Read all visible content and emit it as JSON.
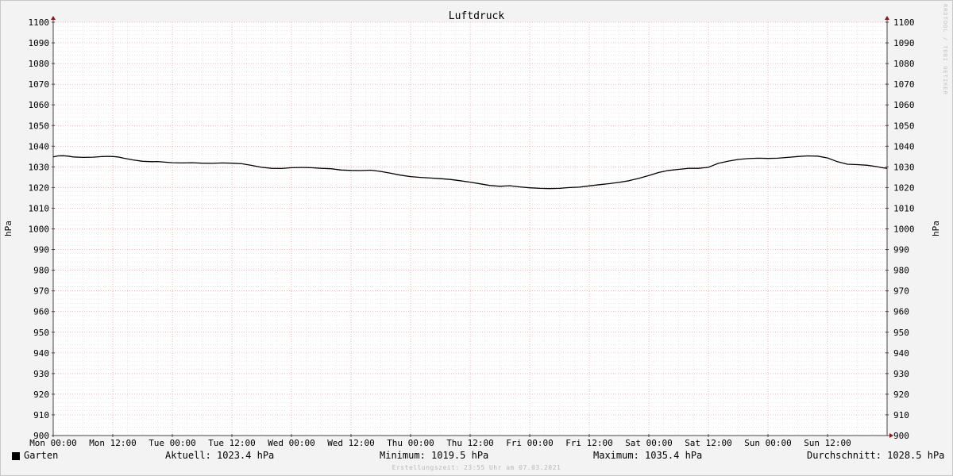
{
  "chart_data": {
    "type": "line",
    "title": "Luftdruck",
    "ylabel_left": "hPa",
    "ylabel_right": "hPa",
    "ylim": [
      900,
      1100
    ],
    "y_ticks": [
      900,
      910,
      920,
      930,
      940,
      950,
      960,
      970,
      980,
      990,
      1000,
      1010,
      1020,
      1030,
      1040,
      1050,
      1060,
      1070,
      1080,
      1090,
      1100
    ],
    "x_unit": "hours since Mon 00:00",
    "xlim": [
      0,
      168
    ],
    "x_ticks": [
      {
        "x": 0,
        "label": "Mon 00:00"
      },
      {
        "x": 12,
        "label": "Mon 12:00"
      },
      {
        "x": 24,
        "label": "Tue 00:00"
      },
      {
        "x": 36,
        "label": "Tue 12:00"
      },
      {
        "x": 48,
        "label": "Wed 00:00"
      },
      {
        "x": 60,
        "label": "Wed 12:00"
      },
      {
        "x": 72,
        "label": "Thu 00:00"
      },
      {
        "x": 84,
        "label": "Thu 12:00"
      },
      {
        "x": 96,
        "label": "Fri 00:00"
      },
      {
        "x": 108,
        "label": "Fri 12:00"
      },
      {
        "x": 120,
        "label": "Sat 00:00"
      },
      {
        "x": 132,
        "label": "Sat 12:00"
      },
      {
        "x": 144,
        "label": "Sun 00:00"
      },
      {
        "x": 156,
        "label": "Sun 12:00"
      }
    ],
    "grid": true,
    "series": [
      {
        "name": "Garten",
        "color": "#000000",
        "x": [
          0,
          1,
          2,
          3,
          4,
          6,
          8,
          10,
          11,
          12,
          13,
          14,
          16,
          18,
          20,
          21,
          22,
          23,
          24,
          26,
          28,
          30,
          32,
          34,
          36,
          38,
          40,
          42,
          44,
          46,
          48,
          50,
          52,
          54,
          56,
          58,
          60,
          62,
          64,
          66,
          68,
          70,
          72,
          74,
          76,
          78,
          80,
          82,
          84,
          86,
          88,
          90,
          92,
          94,
          96,
          98,
          100,
          102,
          104,
          106,
          108,
          110,
          112,
          114,
          116,
          118,
          120,
          122,
          124,
          126,
          128,
          130,
          132,
          133,
          134,
          136,
          138,
          140,
          142,
          144,
          146,
          148,
          150,
          152,
          154,
          156,
          158,
          160,
          162,
          164,
          166,
          167,
          168
        ],
        "values": [
          1034.8,
          1035.3,
          1035.4,
          1035.2,
          1034.8,
          1034.6,
          1034.7,
          1035.0,
          1035.1,
          1035.0,
          1034.8,
          1034.3,
          1033.4,
          1032.7,
          1032.5,
          1032.6,
          1032.4,
          1032.2,
          1032.0,
          1031.9,
          1032.0,
          1031.8,
          1031.7,
          1031.9,
          1031.8,
          1031.5,
          1030.7,
          1029.8,
          1029.3,
          1029.2,
          1029.6,
          1029.7,
          1029.6,
          1029.3,
          1029.1,
          1028.5,
          1028.3,
          1028.2,
          1028.4,
          1027.8,
          1026.9,
          1026.0,
          1025.3,
          1024.9,
          1024.6,
          1024.3,
          1023.9,
          1023.3,
          1022.6,
          1021.8,
          1021.0,
          1020.6,
          1020.9,
          1020.3,
          1019.9,
          1019.6,
          1019.5,
          1019.6,
          1020.0,
          1020.2,
          1020.8,
          1021.4,
          1021.9,
          1022.5,
          1023.3,
          1024.5,
          1025.8,
          1027.3,
          1028.3,
          1028.8,
          1029.3,
          1029.3,
          1029.8,
          1030.8,
          1031.7,
          1032.8,
          1033.6,
          1034.0,
          1034.2,
          1034.1,
          1034.2,
          1034.6,
          1035.0,
          1035.3,
          1035.2,
          1034.3,
          1032.5,
          1031.3,
          1031.1,
          1030.8,
          1030.1,
          1029.6,
          1029.3
        ]
      }
    ],
    "legend": {
      "name": "Garten",
      "current": "Aktuell: 1023.4 hPa",
      "minimum": "Minimum: 1019.5 hPa",
      "maximum": "Maximum: 1035.4 hPa",
      "average": "Durchschnitt: 1028.5 hPa"
    },
    "footer": "Erstellungszeit: 23:55 Uhr am 07.03.2021",
    "credit": "RRDTOOL / TOBI OETIKER"
  }
}
